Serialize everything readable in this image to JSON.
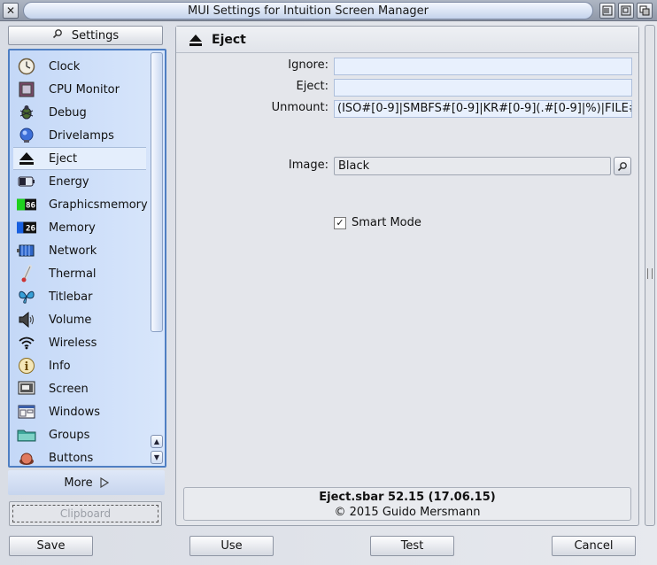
{
  "window": {
    "title": "MUI Settings for Intuition Screen Manager"
  },
  "sidebar": {
    "header_label": "Settings",
    "items": [
      {
        "label": "Clock",
        "icon": "clock-icon"
      },
      {
        "label": "CPU Monitor",
        "icon": "cpu-icon"
      },
      {
        "label": "Debug",
        "icon": "bug-icon"
      },
      {
        "label": "Drivelamps",
        "icon": "lamp-icon"
      },
      {
        "label": "Eject",
        "icon": "eject-icon"
      },
      {
        "label": "Energy",
        "icon": "battery-icon"
      },
      {
        "label": "Graphicsmemory",
        "icon": "graphics-memory-icon",
        "badge": "86"
      },
      {
        "label": "Memory",
        "icon": "memory-icon",
        "badge": "26"
      },
      {
        "label": "Network",
        "icon": "network-icon"
      },
      {
        "label": "Thermal",
        "icon": "thermometer-icon"
      },
      {
        "label": "Titlebar",
        "icon": "butterfly-icon"
      },
      {
        "label": "Volume",
        "icon": "speaker-icon"
      },
      {
        "label": "Wireless",
        "icon": "wifi-icon"
      },
      {
        "label": "Info",
        "icon": "info-icon"
      },
      {
        "label": "Screen",
        "icon": "screen-icon"
      },
      {
        "label": "Windows",
        "icon": "windows-icon"
      },
      {
        "label": "Groups",
        "icon": "folder-icon"
      },
      {
        "label": "Buttons",
        "icon": "button-icon"
      }
    ],
    "selected": "Eject",
    "more_label": "More",
    "clipboard_label": "Clipboard"
  },
  "panel": {
    "title": "Eject",
    "ignore_label": "Ignore:",
    "ignore_value": "",
    "eject_label": "Eject:",
    "eject_value": "",
    "unmount_label": "Unmount:",
    "unmount_value": "(ISO#[0-9]|SMBFS#[0-9]|KR#[0-9](.#[0-9]|%)|FILE#",
    "image_label": "Image:",
    "image_value": "Black",
    "smart_mode_label": "Smart Mode",
    "smart_mode_checked": true,
    "info_line1": "Eject.sbar 52.15 (17.06.15)",
    "info_line2": "© 2015 Guido Mersmann"
  },
  "buttons": {
    "save": "Save",
    "use": "Use",
    "test": "Test",
    "cancel": "Cancel"
  }
}
